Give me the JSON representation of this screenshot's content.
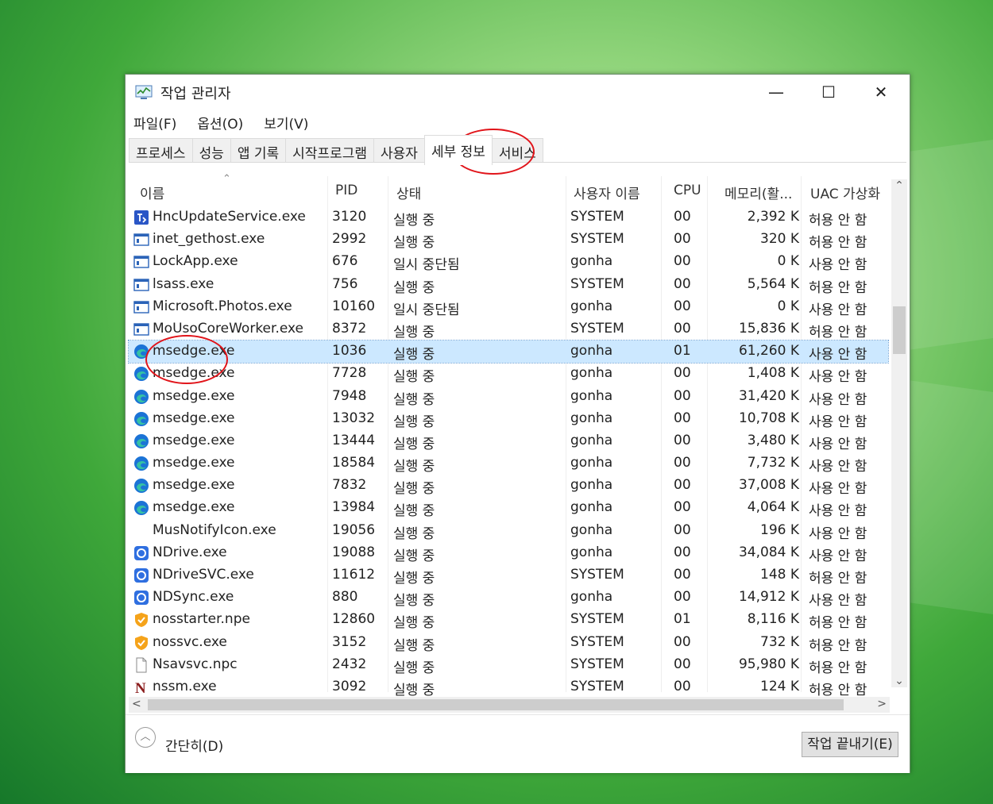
{
  "window": {
    "title": "작업 관리자",
    "controls": {
      "minimize": "—",
      "maximize": "☐",
      "close": "✕"
    }
  },
  "menu": [
    "파일(F)",
    "옵션(O)",
    "보기(V)"
  ],
  "tabs": [
    {
      "label": "프로세스",
      "active": false
    },
    {
      "label": "성능",
      "active": false
    },
    {
      "label": "앱 기록",
      "active": false
    },
    {
      "label": "시작프로그램",
      "active": false
    },
    {
      "label": "사용자",
      "active": false
    },
    {
      "label": "세부 정보",
      "active": true
    },
    {
      "label": "서비스",
      "active": false
    }
  ],
  "columns": {
    "name": "이름",
    "pid": "PID",
    "status": "상태",
    "user": "사용자 이름",
    "cpu": "CPU",
    "memory": "메모리(활...",
    "uac": "UAC 가상화"
  },
  "rows": [
    {
      "icon": "hnc-update-icon",
      "name": "HncUpdateService.exe",
      "pid": "3120",
      "status": "실행 중",
      "user": "SYSTEM",
      "cpu": "00",
      "mem": "2,392 K",
      "uac": "허용 안 함"
    },
    {
      "icon": "app-window-icon",
      "name": "inet_gethost.exe",
      "pid": "2992",
      "status": "실행 중",
      "user": "SYSTEM",
      "cpu": "00",
      "mem": "320 K",
      "uac": "허용 안 함"
    },
    {
      "icon": "app-window-icon",
      "name": "LockApp.exe",
      "pid": "676",
      "status": "일시 중단됨",
      "user": "gonha",
      "cpu": "00",
      "mem": "0 K",
      "uac": "사용 안 함"
    },
    {
      "icon": "app-window-icon",
      "name": "lsass.exe",
      "pid": "756",
      "status": "실행 중",
      "user": "SYSTEM",
      "cpu": "00",
      "mem": "5,564 K",
      "uac": "허용 안 함"
    },
    {
      "icon": "app-window-icon",
      "name": "Microsoft.Photos.exe",
      "pid": "10160",
      "status": "일시 중단됨",
      "user": "gonha",
      "cpu": "00",
      "mem": "0 K",
      "uac": "사용 안 함"
    },
    {
      "icon": "app-window-icon",
      "name": "MoUsoCoreWorker.exe",
      "pid": "8372",
      "status": "실행 중",
      "user": "SYSTEM",
      "cpu": "00",
      "mem": "15,836 K",
      "uac": "허용 안 함"
    },
    {
      "icon": "edge-icon",
      "name": "msedge.exe",
      "pid": "1036",
      "status": "실행 중",
      "user": "gonha",
      "cpu": "01",
      "mem": "61,260 K",
      "uac": "사용 안 함",
      "selected": true
    },
    {
      "icon": "edge-icon",
      "name": "msedge.exe",
      "pid": "7728",
      "status": "실행 중",
      "user": "gonha",
      "cpu": "00",
      "mem": "1,408 K",
      "uac": "사용 안 함"
    },
    {
      "icon": "edge-icon",
      "name": "msedge.exe",
      "pid": "7948",
      "status": "실행 중",
      "user": "gonha",
      "cpu": "00",
      "mem": "31,420 K",
      "uac": "사용 안 함"
    },
    {
      "icon": "edge-icon",
      "name": "msedge.exe",
      "pid": "13032",
      "status": "실행 중",
      "user": "gonha",
      "cpu": "00",
      "mem": "10,708 K",
      "uac": "사용 안 함"
    },
    {
      "icon": "edge-icon",
      "name": "msedge.exe",
      "pid": "13444",
      "status": "실행 중",
      "user": "gonha",
      "cpu": "00",
      "mem": "3,480 K",
      "uac": "사용 안 함"
    },
    {
      "icon": "edge-icon",
      "name": "msedge.exe",
      "pid": "18584",
      "status": "실행 중",
      "user": "gonha",
      "cpu": "00",
      "mem": "7,732 K",
      "uac": "사용 안 함"
    },
    {
      "icon": "edge-icon",
      "name": "msedge.exe",
      "pid": "7832",
      "status": "실행 중",
      "user": "gonha",
      "cpu": "00",
      "mem": "37,008 K",
      "uac": "사용 안 함"
    },
    {
      "icon": "edge-icon",
      "name": "msedge.exe",
      "pid": "13984",
      "status": "실행 중",
      "user": "gonha",
      "cpu": "00",
      "mem": "4,064 K",
      "uac": "사용 안 함"
    },
    {
      "icon": "none",
      "name": "MusNotifyIcon.exe",
      "pid": "19056",
      "status": "실행 중",
      "user": "gonha",
      "cpu": "00",
      "mem": "196 K",
      "uac": "사용 안 함"
    },
    {
      "icon": "ndrive-icon",
      "name": "NDrive.exe",
      "pid": "19088",
      "status": "실행 중",
      "user": "gonha",
      "cpu": "00",
      "mem": "34,084 K",
      "uac": "사용 안 함"
    },
    {
      "icon": "ndrive-icon",
      "name": "NDriveSVC.exe",
      "pid": "11612",
      "status": "실행 중",
      "user": "SYSTEM",
      "cpu": "00",
      "mem": "148 K",
      "uac": "허용 안 함"
    },
    {
      "icon": "ndrive-icon",
      "name": "NDSync.exe",
      "pid": "880",
      "status": "실행 중",
      "user": "gonha",
      "cpu": "00",
      "mem": "14,912 K",
      "uac": "사용 안 함"
    },
    {
      "icon": "shield-icon",
      "name": "nosstarter.npe",
      "pid": "12860",
      "status": "실행 중",
      "user": "SYSTEM",
      "cpu": "01",
      "mem": "8,116 K",
      "uac": "허용 안 함"
    },
    {
      "icon": "shield-icon",
      "name": "nossvc.exe",
      "pid": "3152",
      "status": "실행 중",
      "user": "SYSTEM",
      "cpu": "00",
      "mem": "732 K",
      "uac": "허용 안 함"
    },
    {
      "icon": "blank-file-icon",
      "name": "Nsavsvc.npc",
      "pid": "2432",
      "status": "실행 중",
      "user": "SYSTEM",
      "cpu": "00",
      "mem": "95,980 K",
      "uac": "허용 안 함"
    },
    {
      "icon": "n-logo-icon",
      "name": "nssm.exe",
      "pid": "3092",
      "status": "실행 중",
      "user": "SYSTEM",
      "cpu": "00",
      "mem": "124 K",
      "uac": "허용 안 함"
    }
  ],
  "footer": {
    "collapse_label": "간단히(D)",
    "end_task_label": "작업 끝내기(E)"
  },
  "colors": {
    "selected_row": "#cce8ff",
    "annotation": "#e1141a",
    "edge_blue": "#1b73d6"
  }
}
